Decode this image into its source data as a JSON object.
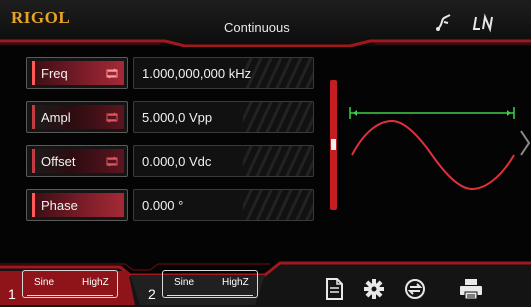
{
  "header": {
    "logo": "RIGOL",
    "mode": "Continuous"
  },
  "params": [
    {
      "label": "Freq",
      "value": "1.000,000,000 kHz"
    },
    {
      "label": "Ampl",
      "value": "5.000,0 Vpp"
    },
    {
      "label": "Offset",
      "value": "0.000,0 Vdc"
    },
    {
      "label": "Phase",
      "value": "0.000 °"
    }
  ],
  "channels": [
    {
      "number": "1",
      "waveform": "Sine",
      "load": "HighZ"
    },
    {
      "number": "2",
      "waveform": "Sine",
      "load": "HighZ"
    }
  ],
  "icons": {
    "header": [
      "usb-icon",
      "lan-icon"
    ],
    "param_toggle": "switch-arrows-icon",
    "footer": [
      "document-icon",
      "settings-gear-icon",
      "channel-sync-icon",
      "printer-icon"
    ]
  },
  "colors": {
    "accent": "#c41e22",
    "logo": "#e7a528",
    "waveform": "#e0303a",
    "marker": "#3ccf4a"
  }
}
